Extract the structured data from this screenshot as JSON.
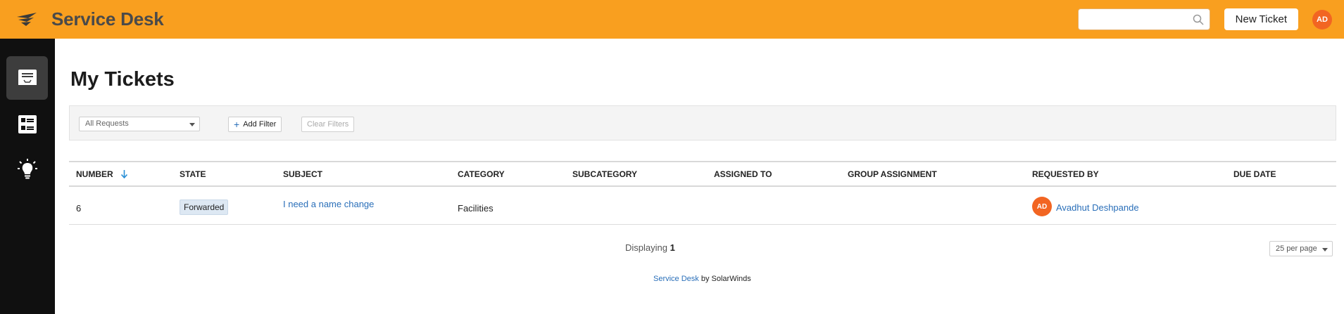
{
  "header": {
    "app_title": "Service Desk",
    "search_placeholder": "",
    "new_ticket_label": "New Ticket",
    "user_initials": "AD",
    "colors": {
      "bar": "#f99f1f",
      "avatar": "#f26522"
    }
  },
  "sidebar": {
    "items": [
      {
        "name": "tickets",
        "icon": "inbox-icon",
        "active": true
      },
      {
        "name": "service-catalog",
        "icon": "catalog-list-icon",
        "active": false
      },
      {
        "name": "knowledge-base",
        "icon": "lightbulb-icon",
        "active": false
      }
    ]
  },
  "page": {
    "title": "My Tickets"
  },
  "filters": {
    "view_select": "All Requests",
    "add_filter_label": "Add Filter",
    "clear_filters_label": "Clear Filters"
  },
  "table": {
    "columns": [
      "Number",
      "State",
      "Subject",
      "Category",
      "Subcategory",
      "Assigned To",
      "Group Assignment",
      "Requested By",
      "Due Date"
    ],
    "sorted_column": "Number",
    "rows": [
      {
        "number": "6",
        "state": "Forwarded",
        "subject": "I need a name change",
        "category": "Facilities",
        "subcategory": "",
        "assigned_to": "",
        "group_assignment": "",
        "requested_by_initials": "AD",
        "requested_by": "Avadhut Deshpande",
        "due_date": ""
      }
    ]
  },
  "pagination": {
    "displaying_label": "Displaying",
    "displaying_count": "1",
    "per_page": "25 per page"
  },
  "footer": {
    "product_link": "Service Desk",
    "by_text": "by SolarWinds"
  }
}
